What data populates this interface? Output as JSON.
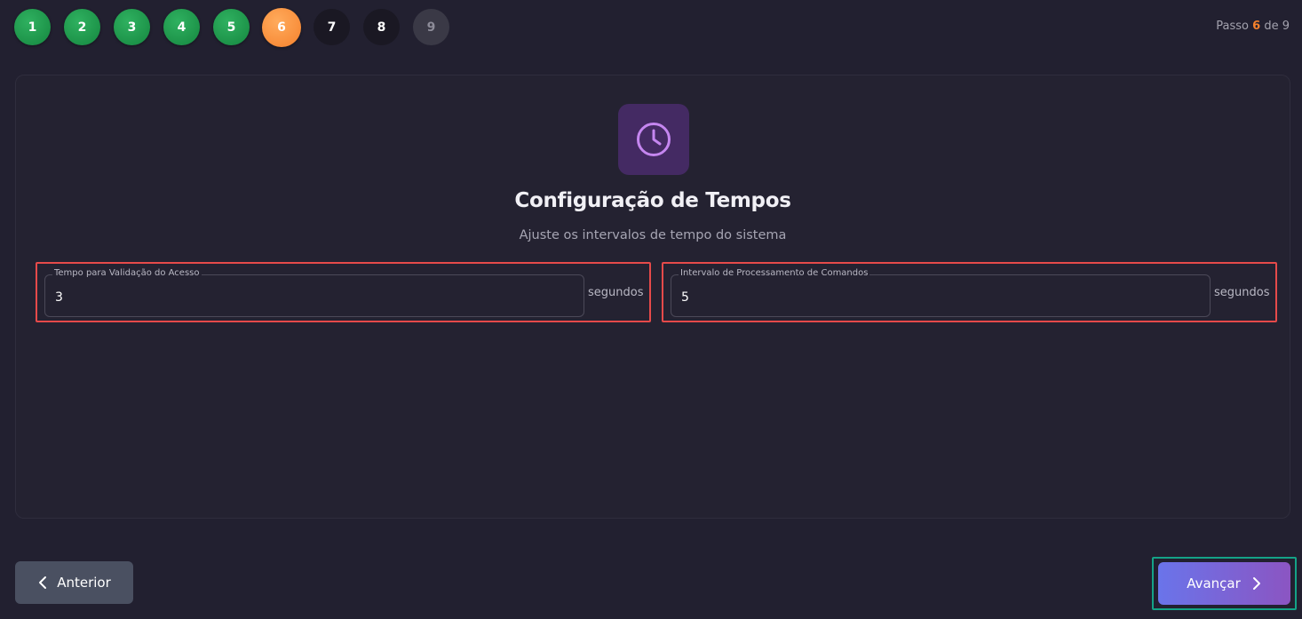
{
  "stepper": {
    "steps": [
      {
        "label": "1",
        "state": "done"
      },
      {
        "label": "2",
        "state": "done"
      },
      {
        "label": "3",
        "state": "done"
      },
      {
        "label": "4",
        "state": "done"
      },
      {
        "label": "5",
        "state": "done"
      },
      {
        "label": "6",
        "state": "current"
      },
      {
        "label": "7",
        "state": "todo"
      },
      {
        "label": "8",
        "state": "todo"
      },
      {
        "label": "9",
        "state": "todo-dim"
      }
    ],
    "counter": {
      "prefix": "Passo",
      "current": "6",
      "middle": "de",
      "total": "9"
    }
  },
  "card": {
    "icon": "clock-icon",
    "title": "Configuração de Tempos",
    "subtitle": "Ajuste os intervalos de tempo do sistema"
  },
  "fields": {
    "access_validation": {
      "label": "Tempo para Validação do Acesso",
      "value": "3",
      "unit": "segundos"
    },
    "command_interval": {
      "label": "Intervalo de Processamento de Comandos",
      "value": "5",
      "unit": "segundos"
    }
  },
  "nav": {
    "prev_label": "Anterior",
    "next_label": "Avançar"
  },
  "colors": {
    "done": "#1a9a4c",
    "current": "#f5812c",
    "accent_start": "#6a74ea",
    "accent_end": "#8b55c2",
    "highlight_red": "#e64a4a",
    "highlight_green": "#14a387"
  }
}
